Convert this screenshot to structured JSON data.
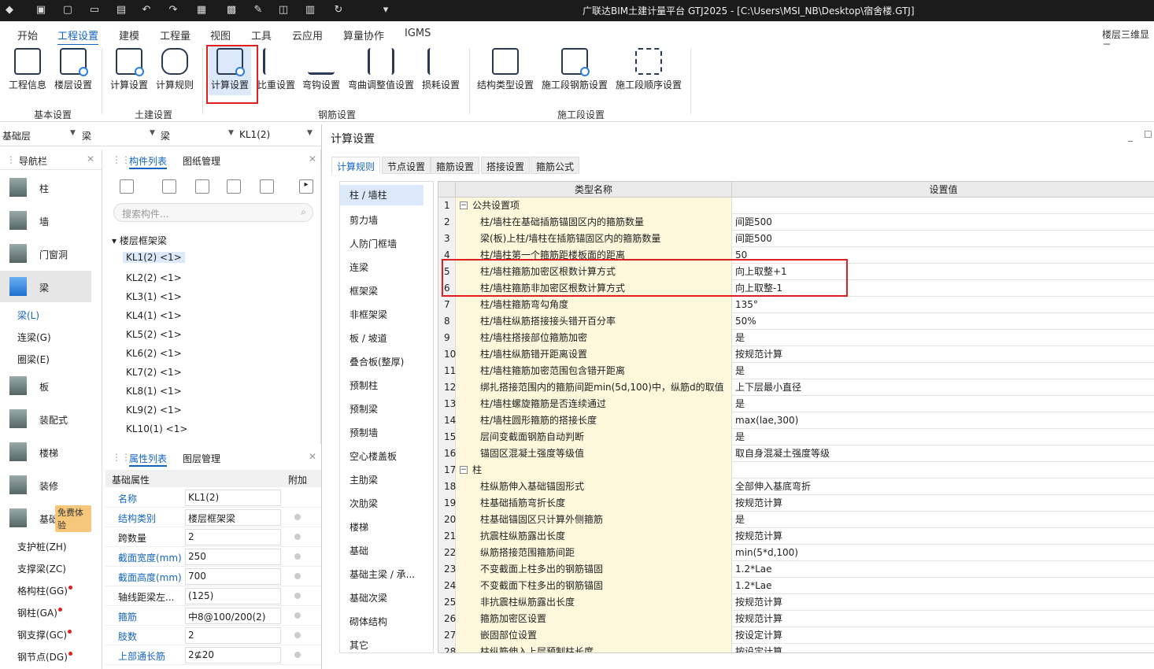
{
  "titlebar": {
    "title": "广联达BIM土建计量平台 GTJ2025 - [C:\\Users\\MSI_NB\\Desktop\\宿舍楼.GTJ]",
    "quick_icons": [
      "app-logo-icon",
      "save-icon",
      "new-icon",
      "open-icon",
      "save-as-icon",
      "undo-icon",
      "redo-icon",
      "grid-icon",
      "table-icon",
      "edit-icon",
      "panel-icon",
      "film-icon",
      "sync-icon",
      "more-icon"
    ]
  },
  "menu": [
    "开始",
    "工程设置",
    "建模",
    "工程量",
    "视图",
    "工具",
    "云应用",
    "算量协作",
    "IGMS"
  ],
  "menu_right": "楼层三维显示",
  "ribbon": {
    "buttons": [
      "工程信息",
      "楼层设置",
      "计算设置",
      "计算规则",
      "计算设置",
      "比重设置",
      "弯钩设置",
      "弯曲调整值设置",
      "损耗设置",
      "结构类型设置",
      "施工段钢筋设置",
      "施工段顺序设置"
    ],
    "groups": [
      "基本设置",
      "土建设置",
      "钢筋设置",
      "施工段设置"
    ]
  },
  "selectors": [
    "基础层",
    "梁",
    "梁",
    "KL1(2)"
  ],
  "nav": {
    "title": "导航栏",
    "items": [
      "柱",
      "墙",
      "门窗洞",
      "梁",
      "板",
      "装配式",
      "楼梯",
      "装修",
      "基础"
    ],
    "beam_sub": [
      "梁(L)",
      "连梁(G)",
      "圈梁(E)"
    ],
    "badge": "免费体验",
    "foundation_sub": [
      "支护桩(ZH)",
      "支撑梁(ZC)",
      "格构柱(GG)",
      "钢柱(GA)",
      "钢支撑(GC)",
      "钢节点(DG)"
    ]
  },
  "component_panel": {
    "tabs": [
      "构件列表",
      "图纸管理"
    ],
    "search_placeholder": "搜索构件...",
    "group": "楼层框架梁",
    "items": [
      "KL1(2) <1>",
      "KL2(2) <1>",
      "KL3(1) <1>",
      "KL4(1) <1>",
      "KL5(2) <1>",
      "KL6(2) <1>",
      "KL7(2) <1>",
      "KL8(1) <1>",
      "KL9(2) <1>",
      "KL10(1) <1>"
    ]
  },
  "props_panel": {
    "tabs": [
      "属性列表",
      "图层管理"
    ],
    "group": "基础属性",
    "extra_col": "附加",
    "rows": [
      {
        "k": "名称",
        "v": "KL1(2)",
        "blue": true
      },
      {
        "k": "结构类别",
        "v": "楼层框架梁",
        "blue": true
      },
      {
        "k": "跨数量",
        "v": "2",
        "blue": false
      },
      {
        "k": "截面宽度(mm)",
        "v": "250",
        "blue": true
      },
      {
        "k": "截面高度(mm)",
        "v": "700",
        "blue": true
      },
      {
        "k": "轴线距梁左...",
        "v": "(125)",
        "blue": false
      },
      {
        "k": "箍筋",
        "v": "中8@100/200(2)",
        "blue": true
      },
      {
        "k": "肢数",
        "v": "2",
        "blue": true
      },
      {
        "k": "上部通长筋",
        "v": "2⊈20",
        "blue": true
      }
    ]
  },
  "dialog": {
    "title": "计算设置",
    "tabs": [
      "计算规则",
      "节点设置",
      "箍筋设置",
      "搭接设置",
      "箍筋公式"
    ],
    "categories": [
      "柱 / 墙柱",
      "剪力墙",
      "人防门框墙",
      "连梁",
      "框架梁",
      "非框架梁",
      "板 / 坡道",
      "叠合板(整厚)",
      "预制柱",
      "预制梁",
      "预制墙",
      "空心楼盖板",
      "主肋梁",
      "次肋梁",
      "楼梯",
      "基础",
      "基础主梁 / 承...",
      "基础次梁",
      "砌体结构",
      "其它"
    ],
    "grid_headers": [
      "类型名称",
      "设置值"
    ],
    "rows": [
      {
        "n": "1",
        "k": "公共设置项",
        "v": "",
        "group": true
      },
      {
        "n": "2",
        "k": "柱/墙柱在基础插筋锚固区内的箍筋数量",
        "v": "间距500"
      },
      {
        "n": "3",
        "k": "梁(板)上柱/墙柱在插筋锚固区内的箍筋数量",
        "v": "间距500"
      },
      {
        "n": "4",
        "k": "柱/墙柱第一个箍筋距楼板面的距离",
        "v": "50"
      },
      {
        "n": "5",
        "k": "柱/墙柱箍筋加密区根数计算方式",
        "v": "向上取整+1"
      },
      {
        "n": "6",
        "k": "柱/墙柱箍筋非加密区根数计算方式",
        "v": "向上取整-1"
      },
      {
        "n": "7",
        "k": "柱/墙柱箍筋弯勾角度",
        "v": "135°"
      },
      {
        "n": "8",
        "k": "柱/墙柱纵筋搭接接头错开百分率",
        "v": "50%"
      },
      {
        "n": "9",
        "k": "柱/墙柱搭接部位箍筋加密",
        "v": "是"
      },
      {
        "n": "10",
        "k": "柱/墙柱纵筋错开距离设置",
        "v": "按规范计算"
      },
      {
        "n": "11",
        "k": "柱/墙柱箍筋加密范围包含错开距离",
        "v": "是"
      },
      {
        "n": "12",
        "k": "绑扎搭接范围内的箍筋间距min(5d,100)中，纵筋d的取值",
        "v": "上下层最小直径"
      },
      {
        "n": "13",
        "k": "柱/墙柱螺旋箍筋是否连续通过",
        "v": "是"
      },
      {
        "n": "14",
        "k": "柱/墙柱圆形箍筋的搭接长度",
        "v": "max(lae,300)"
      },
      {
        "n": "15",
        "k": "层间变截面钢筋自动判断",
        "v": "是"
      },
      {
        "n": "16",
        "k": "锚固区混凝土强度等级值",
        "v": "取自身混凝土强度等级"
      },
      {
        "n": "17",
        "k": "柱",
        "v": "",
        "group": true
      },
      {
        "n": "18",
        "k": "柱纵筋伸入基础锚固形式",
        "v": "全部伸入基底弯折"
      },
      {
        "n": "19",
        "k": "柱基础插筋弯折长度",
        "v": "按规范计算"
      },
      {
        "n": "20",
        "k": "柱基础锚固区只计算外侧箍筋",
        "v": "是"
      },
      {
        "n": "21",
        "k": "抗震柱纵筋露出长度",
        "v": "按规范计算"
      },
      {
        "n": "22",
        "k": "纵筋搭接范围箍筋间距",
        "v": "min(5*d,100)"
      },
      {
        "n": "23",
        "k": "不变截面上柱多出的钢筋锚固",
        "v": "1.2*Lae"
      },
      {
        "n": "24",
        "k": "不变截面下柱多出的钢筋锚固",
        "v": "1.2*Lae"
      },
      {
        "n": "25",
        "k": "非抗震柱纵筋露出长度",
        "v": "按规范计算"
      },
      {
        "n": "26",
        "k": "箍筋加密区设置",
        "v": "按规范计算"
      },
      {
        "n": "27",
        "k": "嵌固部位设置",
        "v": "按设定计算"
      },
      {
        "n": "28",
        "k": "柱纵筋伸入上层预制柱长度",
        "v": "按设定计算"
      }
    ]
  }
}
